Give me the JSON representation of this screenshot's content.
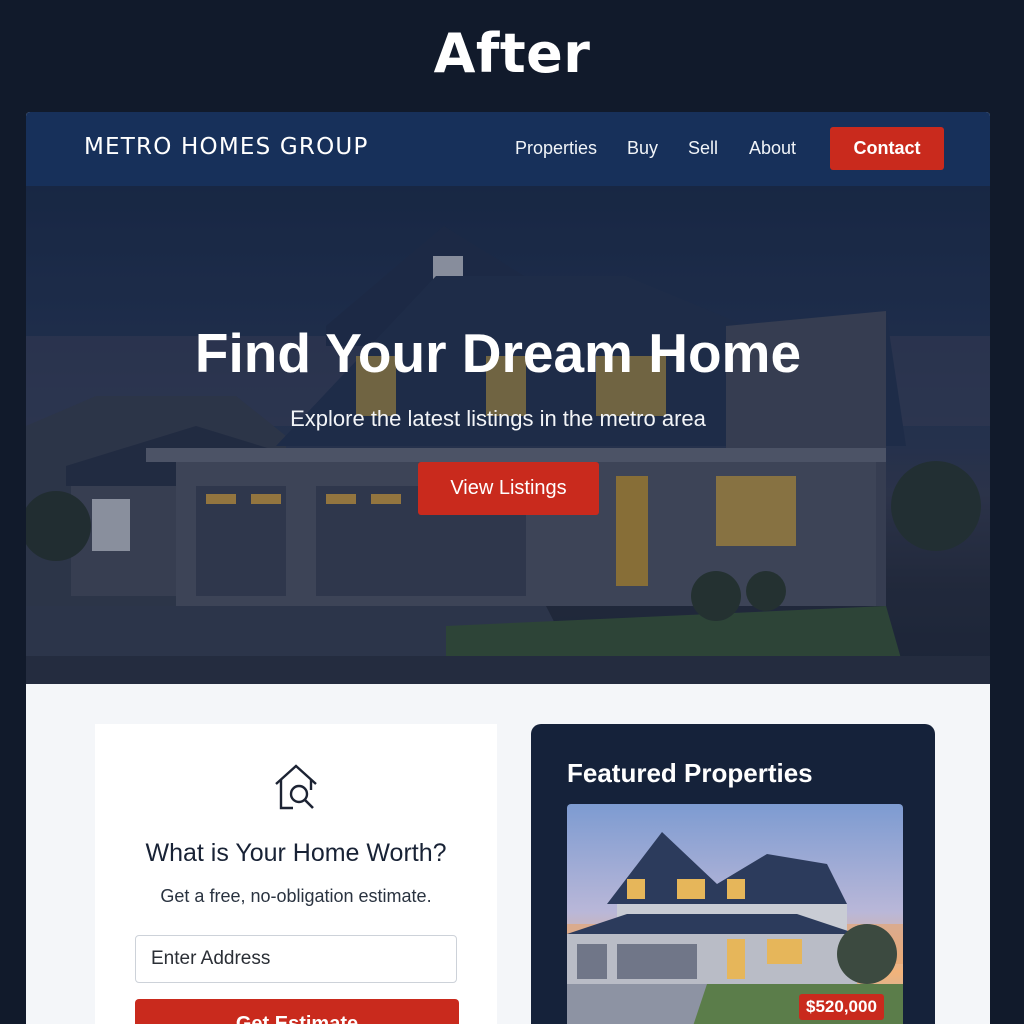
{
  "caption": "After",
  "nav": {
    "brand": "METRO HOMES GROUP",
    "links": [
      "Properties",
      "Buy",
      "Sell",
      "About"
    ],
    "contact_label": "Contact"
  },
  "hero": {
    "title": "Find Your Dream Home",
    "subtitle": "Explore the latest listings in the metro area",
    "cta_label": "View Listings"
  },
  "estimate": {
    "icon": "house-search-icon",
    "title": "What is Your Home Worth?",
    "subtitle": "Get a free, no-obligation estimate.",
    "address_placeholder": "Enter Address",
    "button_label": "Get Estimate"
  },
  "featured": {
    "title": "Featured Properties",
    "listings": [
      {
        "price": "$520,000"
      }
    ]
  },
  "colors": {
    "background": "#111a2b",
    "nav": "#17305a",
    "accent": "#c92a1d",
    "featured_panel": "#15223a"
  }
}
